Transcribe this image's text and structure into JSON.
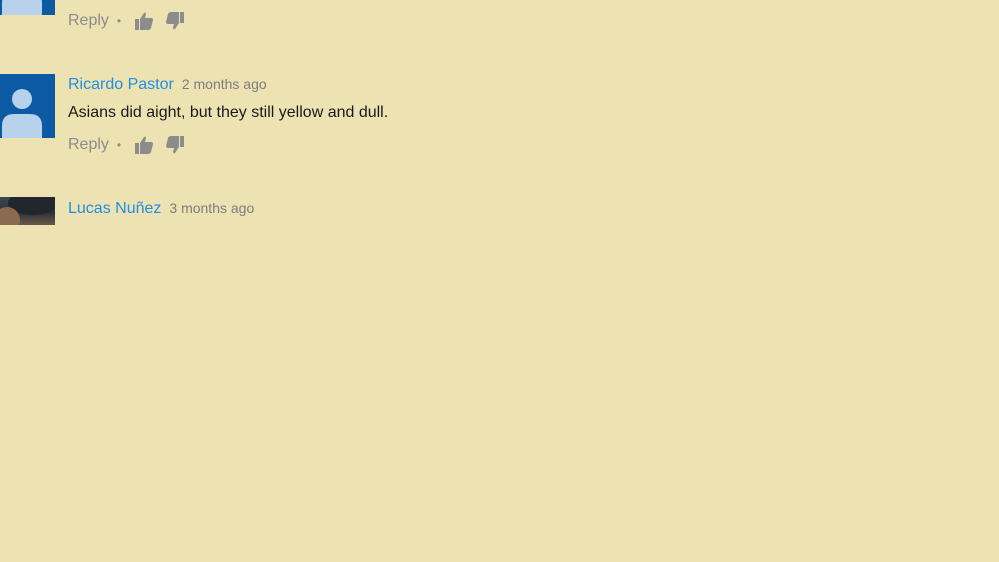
{
  "colors": {
    "page_background": "#EDE2B2",
    "author_link": "#1F8FE5",
    "meta_text": "#7D7D7D",
    "action_icon": "#8C8C8C",
    "default_avatar_bg": "#0B5AA3",
    "default_avatar_figure": "#B7D2EA"
  },
  "comments": [
    {
      "avatar": "default-avatar-icon",
      "actions": {
        "reply_label": "Reply",
        "separator": "•",
        "like_icon": "thumbs-up-icon",
        "dislike_icon": "thumbs-down-icon"
      }
    },
    {
      "avatar": "default-avatar-icon",
      "author": "Ricardo Pastor",
      "time": "2 months ago",
      "text": "Asians did aight, but they still yellow and dull.",
      "actions": {
        "reply_label": "Reply",
        "separator": "•",
        "like_icon": "thumbs-up-icon",
        "dislike_icon": "thumbs-down-icon"
      }
    },
    {
      "avatar": "user-photo",
      "author": "Lucas Nuñez",
      "time": "3 months ago"
    }
  ]
}
